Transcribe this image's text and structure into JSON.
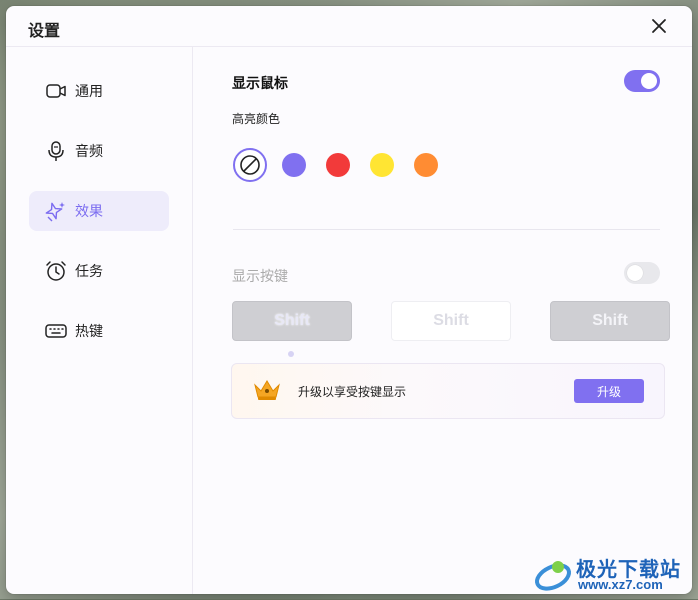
{
  "window": {
    "title": "设置"
  },
  "sidebar": {
    "items": [
      {
        "label": "通用",
        "icon": "camera-icon",
        "active": false
      },
      {
        "label": "音频",
        "icon": "microphone-icon",
        "active": false
      },
      {
        "label": "效果",
        "icon": "sparkle-icon",
        "active": true
      },
      {
        "label": "任务",
        "icon": "alarm-clock-icon",
        "active": false
      },
      {
        "label": "热键",
        "icon": "keyboard-icon",
        "active": false
      }
    ]
  },
  "mouse": {
    "label": "显示鼠标",
    "enabled": true,
    "highlight_label": "高亮颜色",
    "colors": [
      "none",
      "#8070f0",
      "#f23a3a",
      "#ffe533",
      "#ff8c33"
    ],
    "selected_color": "none"
  },
  "keys": {
    "label": "显示按键",
    "enabled": false,
    "styles": [
      "Shift",
      "Shift",
      "Shift"
    ]
  },
  "upgrade": {
    "text": "升级以享受按键显示",
    "button": "升级"
  },
  "watermark": {
    "name": "极光下载站",
    "url": "www.xz7.com"
  },
  "colors": {
    "accent": "#8070f0"
  }
}
